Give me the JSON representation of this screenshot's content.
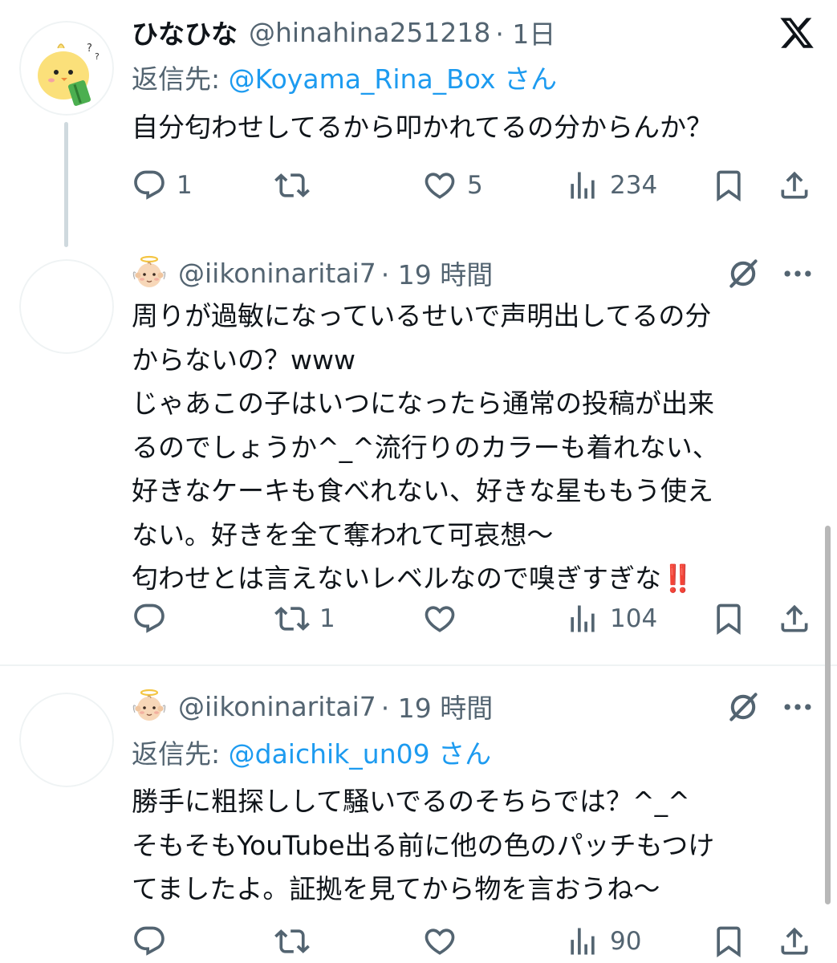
{
  "tweets": [
    {
      "name": "ひなひな",
      "handle": "@hinahina251218",
      "time": "· 1日",
      "reply_prefix": "返信先:",
      "reply_to": "@Koyama_Rina_Box さん",
      "body": "自分匂わせしてるから叩かれてるの分からんか？",
      "replies": "1",
      "retweets": "",
      "likes": "5",
      "views": "234"
    },
    {
      "handle": "@iikoninaritai7",
      "time": "· 19 時間",
      "body": "周りが過敏になっているせいで声明出してるの分\nからないの？www\nじゃあこの子はいつになったら通常の投稿が出来\nるのでしょうか^_^流行りのカラーも着れない、\n好きなケーキも食べれない、好きな星ももう使え\nない。好きを全て奪われて可哀想〜\n匂わせとは言えないレベルなので嗅ぎすぎな",
      "body_emoji": "‼️",
      "replies": "",
      "retweets": "1",
      "likes": "",
      "views": "104"
    },
    {
      "handle": "@iikoninaritai7",
      "time": "· 19 時間",
      "reply_prefix": "返信先:",
      "reply_to": "@daichik_un09 さん",
      "body": "勝手に粗探しして騒いでるのそちらでは？^_^\nそもそもYouTube出る前に他の色のパッチもつけ\nてましたよ。証拠を見てから物を言おうね〜",
      "replies": "",
      "retweets": "",
      "likes": "",
      "views": "90"
    }
  ],
  "icons": {
    "platform": "x-logo-icon",
    "reply": "reply-icon",
    "retweet": "retweet-icon",
    "like": "heart-icon",
    "views": "views-icon",
    "bookmark": "bookmark-icon",
    "share": "share-icon",
    "mute": "grok-icon",
    "more": "more-icon"
  },
  "colors": {
    "text": "#0f1419",
    "secondary": "#536471",
    "link": "#1d9bf0",
    "divider": "#eff3f4"
  }
}
